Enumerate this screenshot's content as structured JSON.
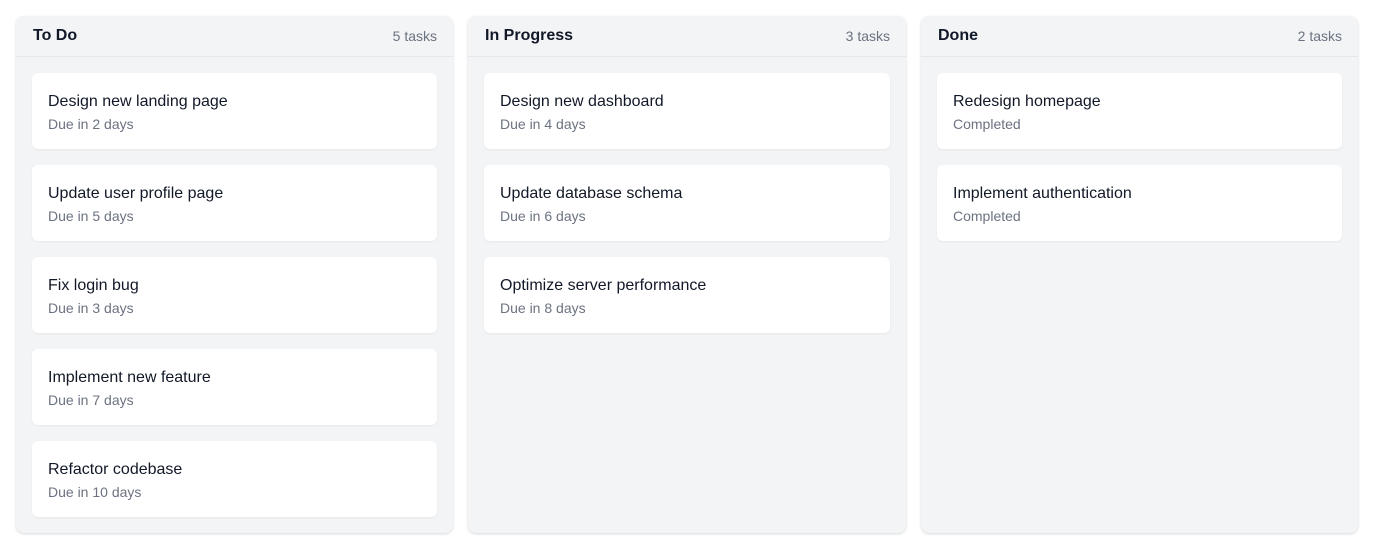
{
  "columns": [
    {
      "title": "To Do",
      "count": "5 tasks",
      "cards": [
        {
          "title": "Design new landing page",
          "subtitle": "Due in 2 days"
        },
        {
          "title": "Update user profile page",
          "subtitle": "Due in 5 days"
        },
        {
          "title": "Fix login bug",
          "subtitle": "Due in 3 days"
        },
        {
          "title": "Implement new feature",
          "subtitle": "Due in 7 days"
        },
        {
          "title": "Refactor codebase",
          "subtitle": "Due in 10 days"
        }
      ]
    },
    {
      "title": "In Progress",
      "count": "3 tasks",
      "cards": [
        {
          "title": "Design new dashboard",
          "subtitle": "Due in 4 days"
        },
        {
          "title": "Update database schema",
          "subtitle": "Due in 6 days"
        },
        {
          "title": "Optimize server performance",
          "subtitle": "Due in 8 days"
        }
      ]
    },
    {
      "title": "Done",
      "count": "2 tasks",
      "cards": [
        {
          "title": "Redesign homepage",
          "subtitle": "Completed"
        },
        {
          "title": "Implement authentication",
          "subtitle": "Completed"
        }
      ]
    }
  ]
}
